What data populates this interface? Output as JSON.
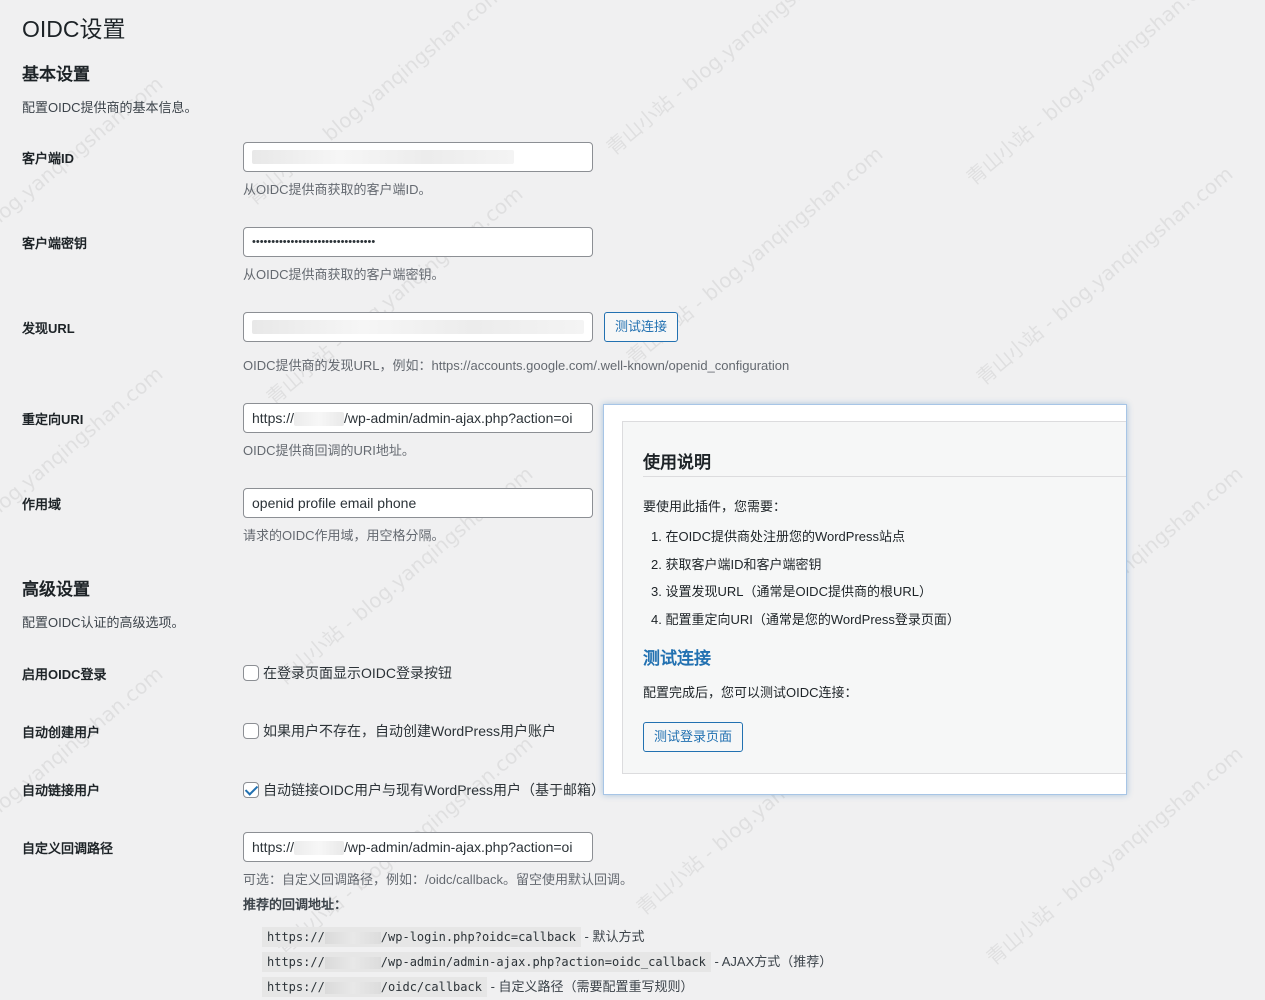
{
  "page": {
    "title": "OIDC设置"
  },
  "basic": {
    "title": "基本设置",
    "description": "配置OIDC提供商的基本信息。",
    "client_id": {
      "label": "客户端ID",
      "description": "从OIDC提供商获取的客户端ID。"
    },
    "client_secret": {
      "label": "客户端密钥",
      "value": "••••••••••••••••••••••••••••••••",
      "description": "从OIDC提供商获取的客户端密钥。"
    },
    "discovery_url": {
      "label": "发现URL",
      "test_button": "测试连接",
      "description": "OIDC提供商的发现URL，例如：https://accounts.google.com/.well-known/openid_configuration"
    },
    "redirect_uri": {
      "label": "重定向URI",
      "value_prefix": "https://",
      "value_suffix": "/wp-admin/admin-ajax.php?action=oi",
      "description": "OIDC提供商回调的URI地址。"
    },
    "scope": {
      "label": "作用域",
      "value": "openid profile email phone",
      "description": "请求的OIDC作用域，用空格分隔。"
    }
  },
  "advanced": {
    "title": "高级设置",
    "description": "配置OIDC认证的高级选项。",
    "enable_login": {
      "label": "启用OIDC登录",
      "checkbox_label": "在登录页面显示OIDC登录按钮",
      "checked": false
    },
    "auto_create": {
      "label": "自动创建用户",
      "checkbox_label": "如果用户不存在，自动创建WordPress用户账户",
      "checked": false
    },
    "auto_link": {
      "label": "自动链接用户",
      "checkbox_label": "自动链接OIDC用户与现有WordPress用户（基于邮箱）",
      "checked": true
    },
    "custom_callback": {
      "label": "自定义回调路径",
      "value_prefix": "https://",
      "value_suffix": "/wp-admin/admin-ajax.php?action=oi",
      "description": "可选：自定义回调路径，例如：/oidc/callback。留空使用默认回调。",
      "recommended_label": "推荐的回调地址：",
      "recommended": [
        {
          "prefix": "https://",
          "path": "/wp-login.php?oidc=callback",
          "note": "- 默认方式"
        },
        {
          "prefix": "https://",
          "path": "/wp-admin/admin-ajax.php?action=oidc_callback",
          "note": "- AJAX方式（推荐）"
        },
        {
          "prefix": "https://",
          "path": "/oidc/callback",
          "note": "- 自定义路径（需要配置重写规则）"
        }
      ]
    }
  },
  "info_panel": {
    "title": "使用说明",
    "intro": "要使用此插件，您需要：",
    "steps": [
      "1. 在OIDC提供商处注册您的WordPress站点",
      "2. 获取客户端ID和客户端密钥",
      "3. 设置发现URL（通常是OIDC提供商的根URL）",
      "4. 配置重定向URI（通常是您的WordPress登录页面）"
    ],
    "test_title": "测试连接",
    "test_intro": "配置完成后，您可以测试OIDC连接：",
    "test_button": "测试登录页面"
  },
  "watermark": {
    "text": "青山小站 - blog.yanqingshan.com"
  }
}
